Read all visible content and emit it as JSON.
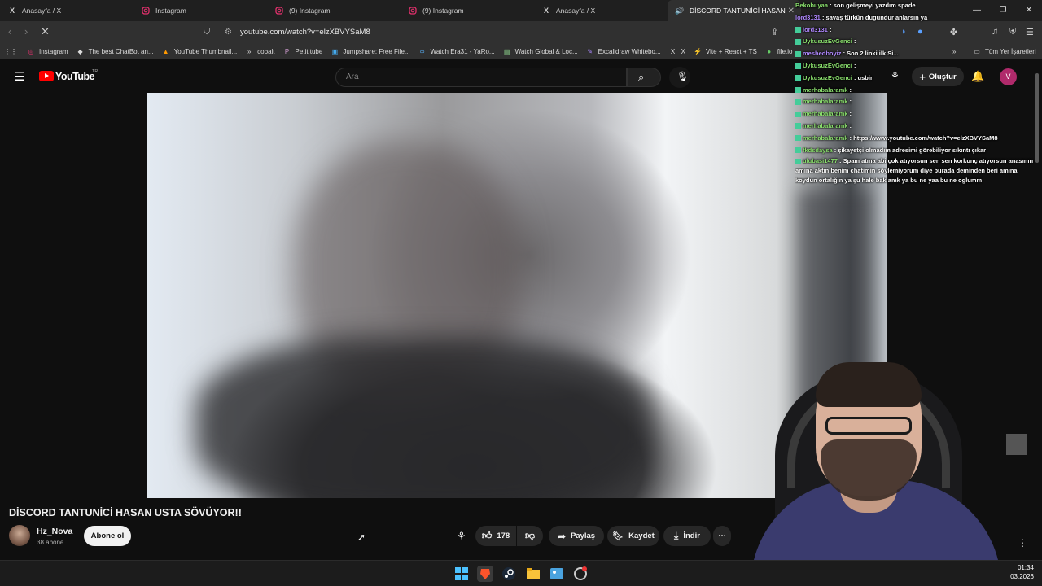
{
  "tabs": [
    {
      "label": "Anasayfa / X",
      "icon": "x-icon"
    },
    {
      "label": "Instagram",
      "icon": "instagram-icon"
    },
    {
      "label": "(9) Instagram",
      "icon": "instagram-icon"
    },
    {
      "label": "(9) Instagram",
      "icon": "instagram-icon"
    },
    {
      "label": "Anasayfa / X",
      "icon": "x-icon"
    },
    {
      "label": "DİSCORD TANTUNİCİ HASAN",
      "icon": "youtube-icon",
      "active": true
    }
  ],
  "address": {
    "url": "youtube.com/watch?v=elzXBVYSaM8"
  },
  "bookmarks": [
    {
      "label": "Instagram",
      "icon": "instagram-icon"
    },
    {
      "label": "The best ChatBot an...",
      "icon": "chatbot-icon"
    },
    {
      "label": "YouTube Thumbnail...",
      "icon": "thumbnail-icon"
    },
    {
      "label": "cobalt",
      "icon": "cobalt-icon"
    },
    {
      "label": "Petit tube",
      "icon": "petit-tube-icon"
    },
    {
      "label": "Jumpshare: Free File...",
      "icon": "jumpshare-icon"
    },
    {
      "label": "Watch Era31 - YaRo...",
      "icon": "watch-icon"
    },
    {
      "label": "Watch Global & Loc...",
      "icon": "watch-icon"
    },
    {
      "label": "Excalidraw Whitebo...",
      "icon": "excalidraw-icon"
    },
    {
      "label": "X",
      "icon": "x-icon"
    },
    {
      "label": "Vite + React + TS",
      "icon": "vite-icon"
    },
    {
      "label": "file.io",
      "icon": "fileio-icon"
    }
  ],
  "bookmarks_all": "Tüm Yer İşaretleri",
  "youtube": {
    "logo": "YouTube",
    "region": "TR",
    "search_placeholder": "Ara",
    "create_label": "Oluştur",
    "avatar_letter": "V"
  },
  "video": {
    "title": "DİSCORD TANTUNİCİ HASAN USTA SÖVÜYOR!!",
    "channel": "Hz_Nova",
    "subscribers": "38 abone",
    "subscribe_label": "Abone ol",
    "likes": "178",
    "share_label": "Paylaş",
    "save_label": "Kaydet",
    "download_label": "İndir"
  },
  "chat": [
    {
      "user": "Bekobuyaa",
      "text": " : son gelişmeyi yazdım spade"
    },
    {
      "user": "lord3131",
      "text": " : savaş türkün dugundur anlarsın ya"
    },
    {
      "user": "lord3131",
      "text": " : "
    },
    {
      "user": "UykusuzEvGenci",
      "text": " : "
    },
    {
      "user": "meshedboyiz",
      "text": " : Son 2 linki ilk Si..."
    },
    {
      "user": "UykusuzEvGenci",
      "text": " : "
    },
    {
      "user": "UykusuzEvGenci",
      "text": " : usbir"
    },
    {
      "user": "merhabalaramk",
      "text": " : "
    },
    {
      "user": "merhabalaramk",
      "text": " : "
    },
    {
      "user": "merhabalaramk",
      "text": " : "
    },
    {
      "user": "merhabalaramk",
      "text": " : "
    },
    {
      "user": "merhabalaramk",
      "text": " : https://www.youtube.com/watch?v=elzXBVYSaM8"
    },
    {
      "user": "fkdsdaysa",
      "text": " : şikayetçi olmadım adresimi görebiliyor sıkıntı çıkar"
    },
    {
      "user": "ulubasi1477",
      "text": " : Spam atma abi çok atıyorsun sen sen korkunç atıyorsun anasının amına aktın benim chatimin söylemiyorum diye burada deminden beri amına koydun ortalığın ya şu hale bak amk ya bu ne yaa bu ne oglumm"
    }
  ],
  "clock": {
    "time": "01:34",
    "date": "03.2026"
  },
  "colors": {
    "youtube_red": "#ff0000",
    "chat_green": "#8adf6d",
    "background": "#0f0f0f"
  }
}
